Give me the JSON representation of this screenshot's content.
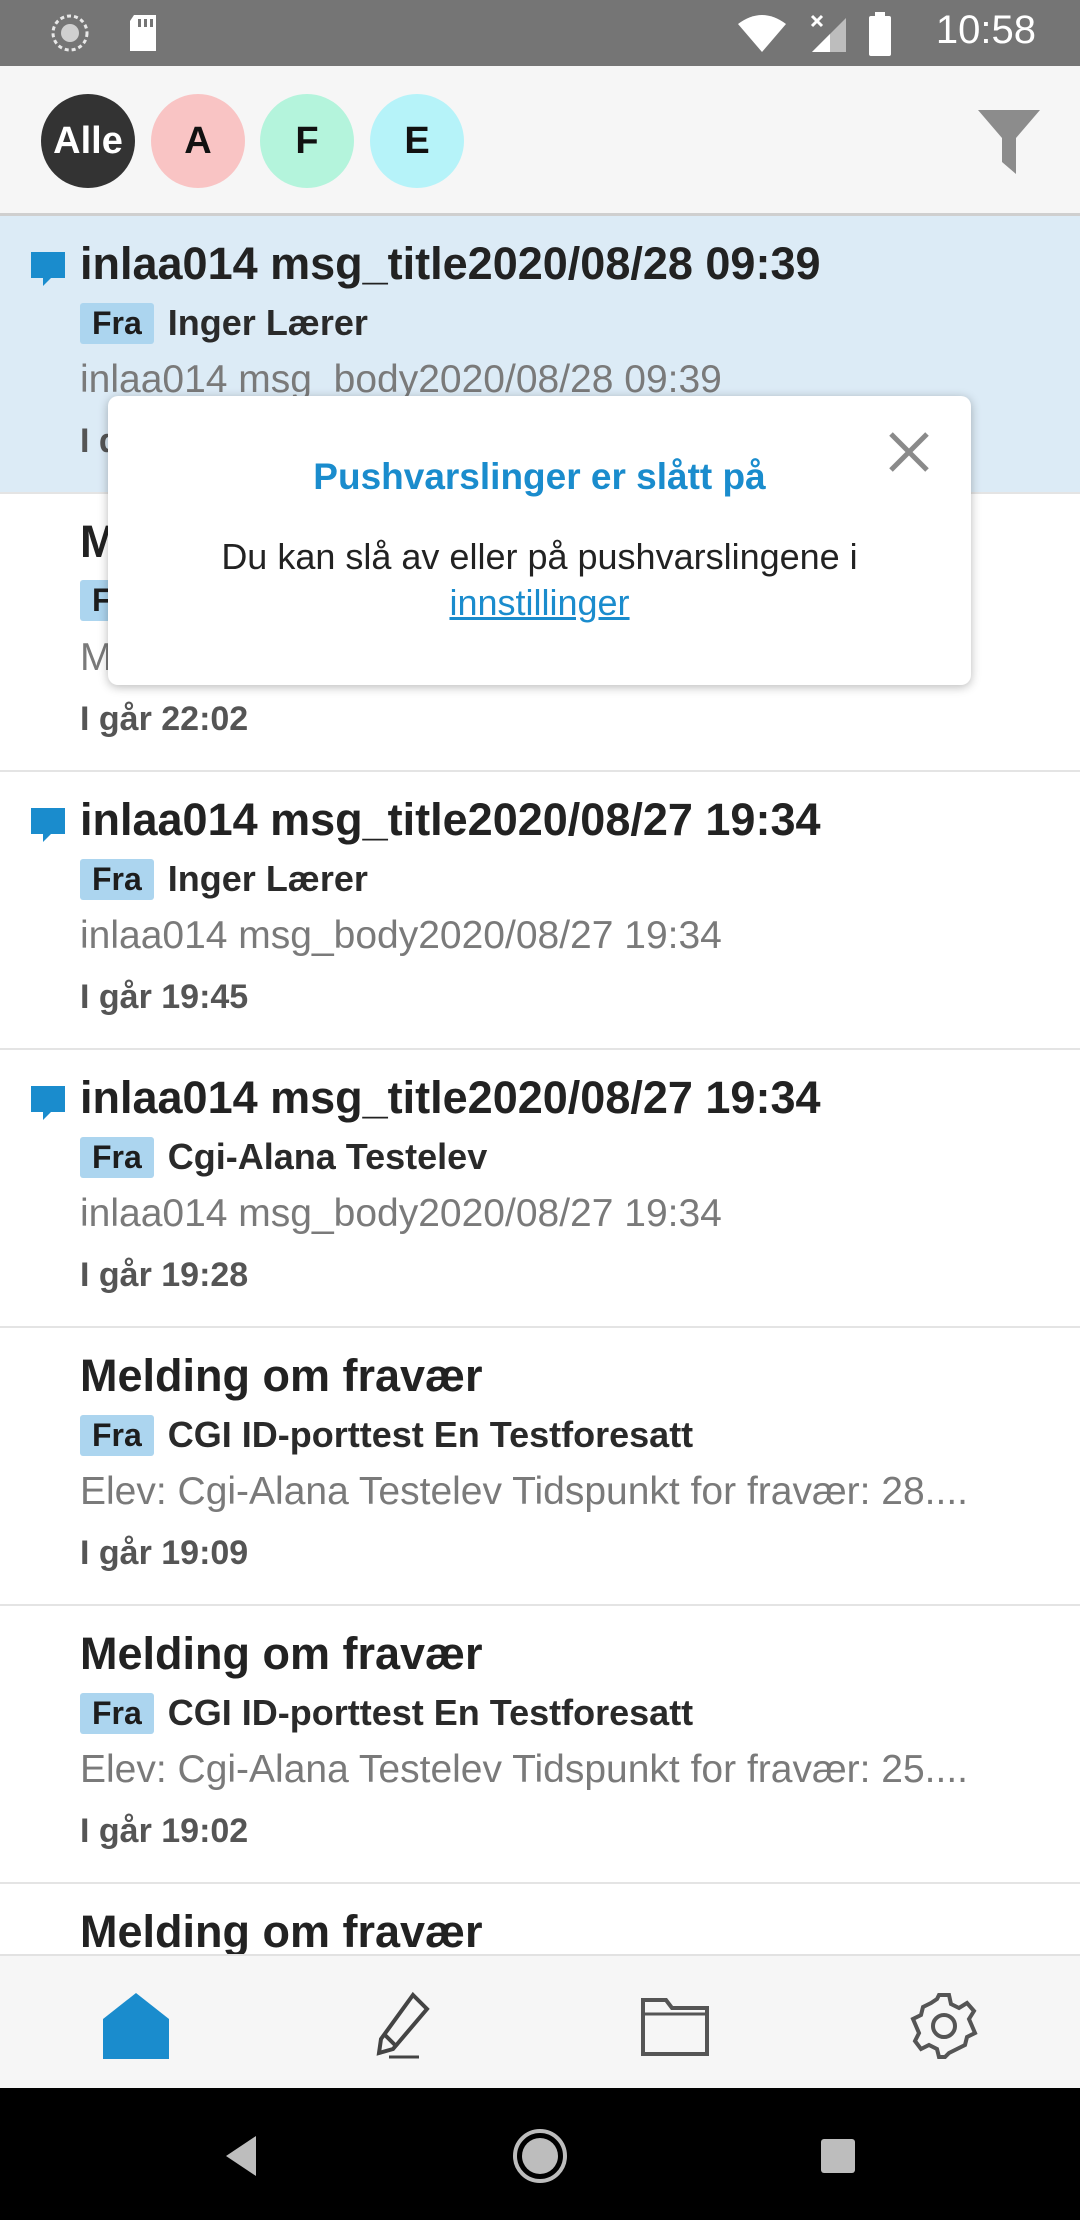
{
  "status_bar": {
    "time": "10:58",
    "left_icons": [
      "sync-icon",
      "sd-card-icon"
    ],
    "right_icons": [
      "wifi-icon",
      "cell-signal-icon",
      "battery-icon"
    ]
  },
  "filter_bar": {
    "chips": [
      {
        "label": "Alle",
        "color": "#333333",
        "selected": true
      },
      {
        "label": "A",
        "color": "#f9c4c4"
      },
      {
        "label": "F",
        "color": "#b4f4dc"
      },
      {
        "label": "E",
        "color": "#b6f3f9"
      }
    ],
    "filter_icon": "filter-icon"
  },
  "messages": [
    {
      "title": "inlaa014 msg_title2020/08/28 09:39",
      "from_label": "Fra",
      "sender": "Inger Lærer",
      "body": "inlaa014 msg_body2020/08/28 09:39",
      "time": "I d",
      "unread": true,
      "selected": true
    },
    {
      "title": "M",
      "from_label": "F",
      "sender": "",
      "body": "M",
      "time": "I går 22:02",
      "unread": false
    },
    {
      "title": "inlaa014 msg_title2020/08/27 19:34",
      "from_label": "Fra",
      "sender": "Inger Lærer",
      "body": "inlaa014 msg_body2020/08/27 19:34",
      "time": "I går 19:45",
      "unread": true
    },
    {
      "title": "inlaa014 msg_title2020/08/27 19:34",
      "from_label": "Fra",
      "sender": "Cgi-Alana Testelev",
      "body": "inlaa014 msg_body2020/08/27 19:34",
      "time": "I går 19:28",
      "unread": true
    },
    {
      "title": "Melding om fravær",
      "from_label": "Fra",
      "sender": "CGI ID-porttest En Testforesatt",
      "body": "Elev: Cgi-Alana Testelev Tidspunkt for fravær: 28....",
      "time": "I går 19:09",
      "unread": false
    },
    {
      "title": "Melding om fravær",
      "from_label": "Fra",
      "sender": "CGI ID-porttest En Testforesatt",
      "body": "Elev: Cgi-Alana Testelev Tidspunkt for fravær: 25....",
      "time": "I går 19:02",
      "unread": false
    },
    {
      "title": "Melding om fravær",
      "from_label": "",
      "sender": "",
      "body": "",
      "time": "",
      "unread": false
    }
  ],
  "popup": {
    "title": "Pushvarslinger er slått på",
    "text": "Du kan slå av eller på pushvarslingene i",
    "link": "innstillinger",
    "close_icon": "close-icon"
  },
  "bottom_nav": {
    "items": [
      {
        "icon": "home-icon",
        "active": true
      },
      {
        "icon": "pencil-icon",
        "active": false
      },
      {
        "icon": "folder-icon",
        "active": false
      },
      {
        "icon": "gear-icon",
        "active": false
      }
    ],
    "accent": "#1a8ccd"
  }
}
